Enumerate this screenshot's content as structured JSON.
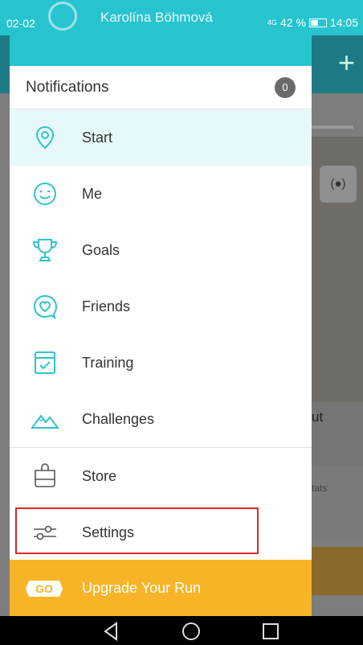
{
  "status_bar": {
    "time_left": "02-02",
    "user_name": "Karolína Böhmová",
    "network": "4G",
    "battery": "42 %",
    "time": "14:05"
  },
  "drawer": {
    "notifications": {
      "label": "Notifications",
      "count": "0"
    },
    "items": [
      {
        "label": "Start",
        "icon": "location-pin-icon",
        "active": true
      },
      {
        "label": "Me",
        "icon": "smiley-face-icon"
      },
      {
        "label": "Goals",
        "icon": "trophy-icon"
      },
      {
        "label": "Friends",
        "icon": "heart-chat-icon"
      },
      {
        "label": "Training",
        "icon": "checklist-icon"
      },
      {
        "label": "Challenges",
        "icon": "mountain-icon"
      },
      {
        "label": "Store",
        "icon": "shopping-bag-icon"
      },
      {
        "label": "Settings",
        "icon": "sliders-icon"
      }
    ],
    "upgrade": {
      "badge": "GO",
      "label": "Upgrade Your Run"
    }
  },
  "background_app": {
    "card_text": "ut",
    "stats_text": "tats",
    "gps_icon": "(●)"
  },
  "colors": {
    "accent": "#27c4cf",
    "icon": "#2fc3cf",
    "upgrade": "#f8b427",
    "highlight": "#d9262c"
  }
}
